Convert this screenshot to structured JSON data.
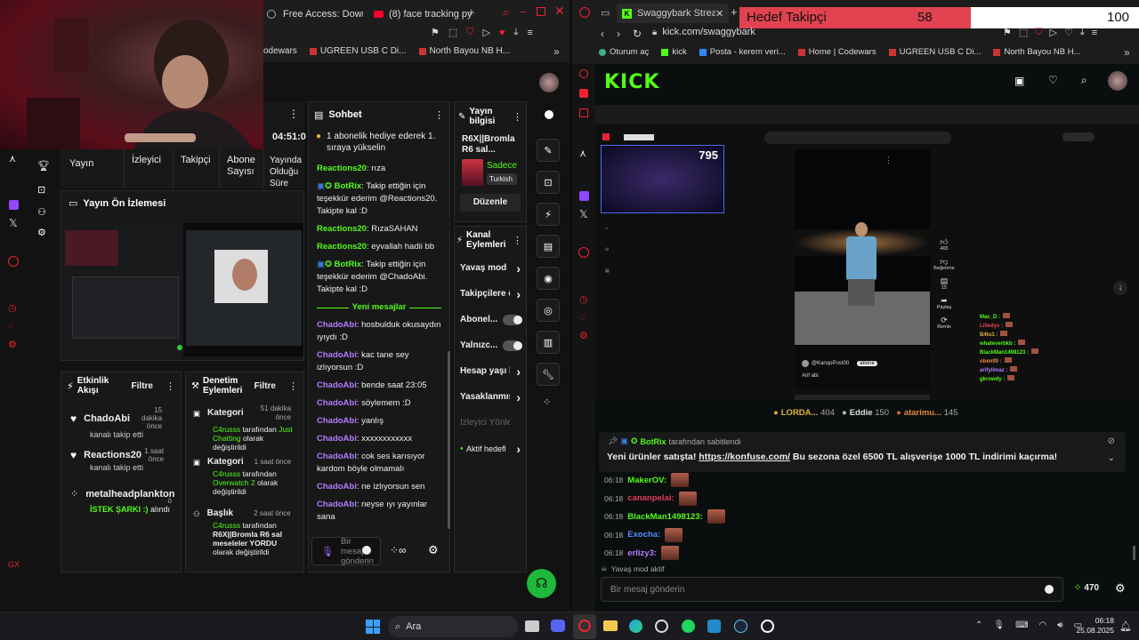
{
  "left_browser": {
    "tabs": [
      {
        "label": "Free Access: Downlo"
      },
      {
        "label": "(8) face tracking pyth"
      }
    ],
    "bookmarks": [
      {
        "label": "odewars"
      },
      {
        "label": "UGREEN USB C Di..."
      },
      {
        "label": "North Bayou NB H..."
      }
    ]
  },
  "dashboard": {
    "stream_time": "04:51:0",
    "stats_headers": {
      "yayin": "Yayın",
      "izleyici": "İzleyici",
      "takipci": "Takipçi",
      "abone": "Abone Sayısı",
      "olduğu": "Yayında Olduğu Süre"
    },
    "preview_title": "Yayın Ön İzlemesi",
    "activity": {
      "title": "Etkinlik Akışı",
      "filter": "Filtre",
      "items": [
        {
          "name": "ChadoAbi",
          "time": "15 dakika önce",
          "text": "kanalı takip etti"
        },
        {
          "name": "Reactions20",
          "time": "1 saat önce",
          "text": "kanalı takip etti"
        },
        {
          "name": "metalheadplankton",
          "time": "ö",
          "text_a": "İSTEK ŞARKI :)",
          "text_b": " alındı"
        }
      ]
    },
    "moderation": {
      "title": "Denetim Eylemleri",
      "filter": "Filtre",
      "items": [
        {
          "title": "Kategori",
          "time": "51 dakika önce",
          "user": "C4russs",
          "mid": " tarafından ",
          "val": "Just Chatting",
          "end": " olarak değiştirildi"
        },
        {
          "title": "Kategori",
          "time": "1 saat önce",
          "user": "C4russs",
          "mid": " tarafından ",
          "val": "Overwatch 2",
          "end": " olarak değiştirildi"
        },
        {
          "title": "Başlık",
          "time": "2 saat önce",
          "user": "C4russs",
          "mid": " tarafından ",
          "val": "R6X||Bromla R6 sal meseleler YORDU",
          "end": " olarak değiştirildi"
        }
      ]
    },
    "chat": {
      "title": "Sohbet",
      "pinned": "1 abonelik hediye ederek 1. sıraya yükselin",
      "new_messages": "Yeni mesajlar",
      "input_placeholder": "Bir mesaj gönderin",
      "msgs": [
        {
          "user": "Reactions20",
          "text": ": rıza"
        },
        {
          "user": "BotRix",
          "text": ": Takip ettiğin için teşekkür ederim @Reactions20. Takipte kal :D"
        },
        {
          "user": "Reactions20",
          "text": ": RızaSAHAN"
        },
        {
          "user": "Reactions20",
          "text": ": eyvallah hadii bb"
        },
        {
          "user": "BotRix",
          "text": ": Takip ettiğin için teşekkür ederim @ChadoAbi. Takipte kal :D"
        }
      ],
      "msgs2": [
        {
          "user": "ChadoAbi",
          "text": ": hosbulduk okusaydın ıyıydı :D"
        },
        {
          "user": "ChadoAbi",
          "text": ": kac tane sey izlıyorsun :D"
        },
        {
          "user": "ChadoAbi",
          "text": ": bende saat 23:05"
        },
        {
          "user": "ChadoAbi",
          "text": ": söylemem :D"
        },
        {
          "user": "ChadoAbi",
          "text": ": yanlış"
        },
        {
          "user": "ChadoAbi",
          "text": ": xxxxxxxxxxxx"
        },
        {
          "user": "ChadoAbi",
          "text": ": cok ses karısıyor kardom böyle olmamalı"
        },
        {
          "user": "ChadoAbi",
          "text": ": ne izlıyorsun sen"
        },
        {
          "user": "ChadoAbi",
          "text": ": neyse ıyı yayınlar sana"
        }
      ]
    },
    "info": {
      "title": "Yayın bilgisi",
      "stream_title": "R6X||Bromla R6 sal...",
      "tag_a": "Sadece",
      "tag_b": "Turkish",
      "edit": "Düzenle"
    },
    "actions": {
      "title": "Kanal Eylemleri",
      "items": [
        {
          "label": "Yavaş mod",
          "type": "arrow"
        },
        {
          "label": "Takipçilere ö",
          "type": "arrow"
        },
        {
          "label": "Abonel...",
          "type": "toggle"
        },
        {
          "label": "Yalnızc...",
          "type": "toggle"
        },
        {
          "label": "Hesap yaşı k",
          "type": "arrow"
        },
        {
          "label": "Yasaklanmış",
          "type": "arrow"
        },
        {
          "label": "İzleyici Yönlendir",
          "type": "none"
        },
        {
          "label": "Aktif hedefl",
          "type": "arrow"
        }
      ]
    }
  },
  "right_browser": {
    "tab": "Swaggybark Stream",
    "goal": {
      "label": "Hedef Takipçi",
      "current": "58",
      "target": "100",
      "progress": 0.58
    },
    "url": "kick.com/swaggybark",
    "bookmarks": [
      {
        "label": "Oturum aç"
      },
      {
        "label": "kick"
      },
      {
        "label": "Posta - kerem veri..."
      },
      {
        "label": "Home | Codewars"
      },
      {
        "label": "UGREEN USB C Di..."
      },
      {
        "label": "North Bayou NB H..."
      }
    ]
  },
  "kick": {
    "logo": "KICK",
    "viewer_count": "795",
    "yt_side": {
      "like": "465",
      "comment": "15",
      "likes_label": "Beğenme",
      "share": "Paylaş",
      "remix": "Remix"
    },
    "video_user": "@KanqoPost00",
    "video_caption": "Arif abi",
    "side_chat": [
      {
        "user": "Mac_D :"
      },
      {
        "user": "Lilledys :"
      },
      {
        "user": "B4tu1 :"
      },
      {
        "user": "whateverbkb :"
      },
      {
        "user": "BlackMan1498123 :"
      },
      {
        "user": "oben99 :"
      },
      {
        "user": "arifyilmaz :"
      },
      {
        "user": "gkrowdy :"
      }
    ],
    "leaderboard": [
      {
        "name": "LORDA...",
        "points": "404"
      },
      {
        "name": "Eddie",
        "points": "150"
      },
      {
        "name": "atarimu...",
        "points": "145"
      }
    ],
    "pin": {
      "by": "BotRix",
      "by_suffix": " tarafından sabitlendi",
      "text_a": "Yeni ürünler satışta! ",
      "link": "https://konfuse.com/",
      "text_b": " Bu sezona özel 6500 TL alışverişe 1000 TL indirimi kaçırma!"
    },
    "messages": [
      {
        "time": "06:18",
        "user": "MakerOV:",
        "color": "#53fc18"
      },
      {
        "time": "06:18",
        "user": "cananpelai:",
        "color": "#e03b5c"
      },
      {
        "time": "06:18",
        "user": "BlackMan1498123:",
        "color": "#53fc18"
      },
      {
        "time": "06:18",
        "user": "Exocha:",
        "color": "#4f8cff"
      },
      {
        "time": "06:18",
        "user": "erlizy3:",
        "color": "#b57cff"
      }
    ],
    "slow_mode": "Yavaş mod aktif",
    "input_placeholder": "Bir mesaj gönderin",
    "points": "470"
  },
  "taskbar": {
    "search": "Ara",
    "time": "06:18",
    "date": "25.08.2025"
  }
}
